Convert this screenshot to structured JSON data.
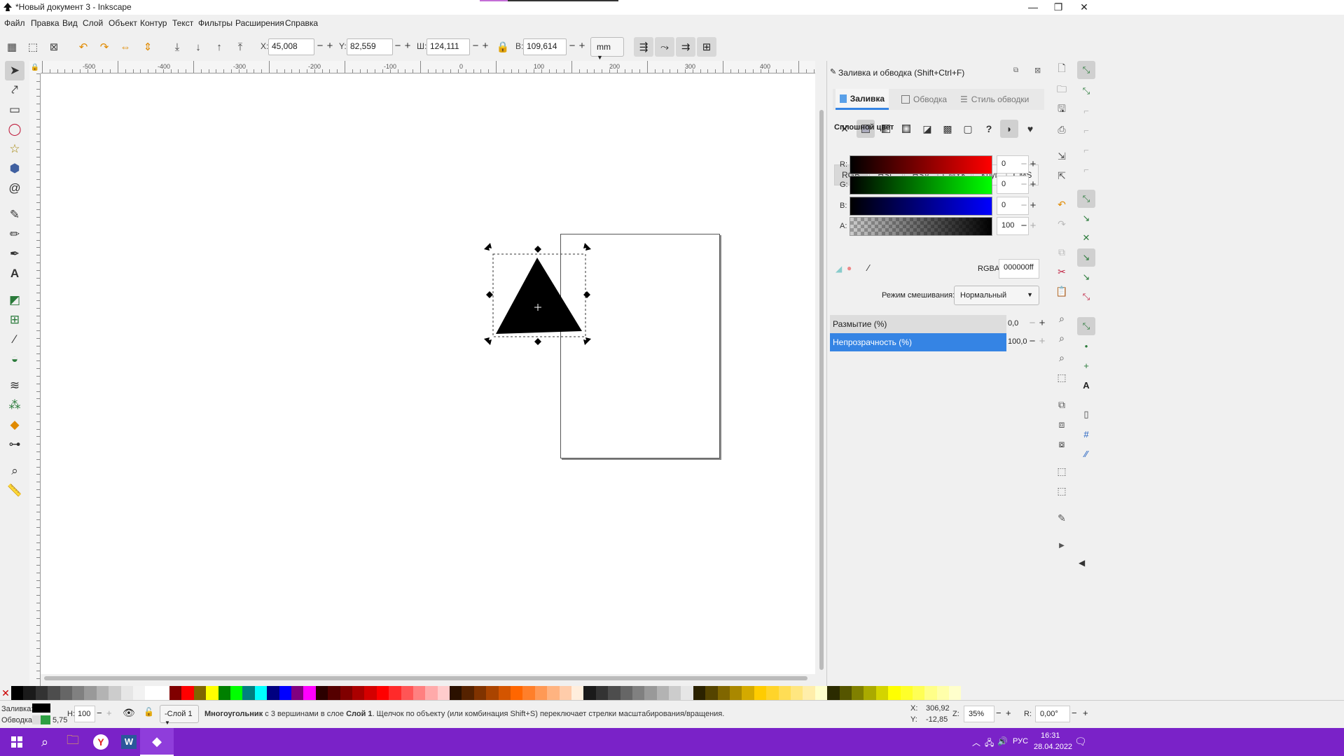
{
  "window": {
    "title": "*Новый документ 3 - Inkscape",
    "controls": [
      "—",
      "❐",
      "✕"
    ]
  },
  "menu": [
    "Файл",
    "Правка",
    "Вид",
    "Слой",
    "Объект",
    "Контур",
    "Текст",
    "Фильтры",
    "Расширения",
    "Справка"
  ],
  "toolctl": {
    "x_label": "X:",
    "x_value": "45,008",
    "y_label": "Y:",
    "y_value": "82,559",
    "w_label": "Ш:",
    "w_value": "124,111",
    "h_label": "В:",
    "h_value": "109,614",
    "unit": "mm"
  },
  "ruler": {
    "labels": [
      "-500",
      "-400",
      "-300",
      "-200",
      "-100",
      "0",
      "100",
      "200",
      "300",
      "400"
    ]
  },
  "dock": {
    "title": "Заливка и обводка (Shift+Ctrl+F)",
    "tabs": [
      "Заливка",
      "Обводка",
      "Стиль обводки"
    ],
    "section": "Сплошной цвет",
    "color_modes": [
      "RGB",
      "HSL",
      "HSV",
      "CMYK",
      "Круг",
      "CMS"
    ],
    "channels": [
      {
        "label": "R:",
        "value": "0"
      },
      {
        "label": "G:",
        "value": "0"
      },
      {
        "label": "B:",
        "value": "0"
      },
      {
        "label": "A:",
        "value": "100"
      }
    ],
    "rgba_label": "RGBA:",
    "rgba_value": "000000ff",
    "blend_label": "Режим смешивания:",
    "blend_value": "Нормальный",
    "blur_label": "Размытие (%)",
    "blur_value": "0,0",
    "opacity_label": "Непрозрачность (%)",
    "opacity_value": "100,0",
    "opacity_level": 1.0
  },
  "status": {
    "fill_label": "Заливка:",
    "stroke_label": "Обводка:",
    "stroke_width": "5,75",
    "h_label": "Н:",
    "h_value": "100",
    "layer": "-Слой 1",
    "msg_bold1": "Многоугольник",
    "msg_part1": " с 3 вершинами в слое ",
    "msg_bold2": "Слой 1",
    "msg_part2": ". Щелчок по объекту (или комбинация Shift+S) переключает стрелки масштабирования/вращения.",
    "x_label": "X:",
    "x_value": "306,92",
    "y_label": "Y:",
    "y_value": "-12,85",
    "z_label": "Z:",
    "zoom": "35%",
    "r_label": "R:",
    "rotation": "0,00°"
  },
  "taskbar": {
    "lang": "РУС",
    "time": "16:31",
    "date": "28.04.2022"
  },
  "colors": {
    "accent": "#3584e4",
    "taskbar": "#7a22c8",
    "fill": "#000000",
    "stroke": "#2ea043"
  }
}
